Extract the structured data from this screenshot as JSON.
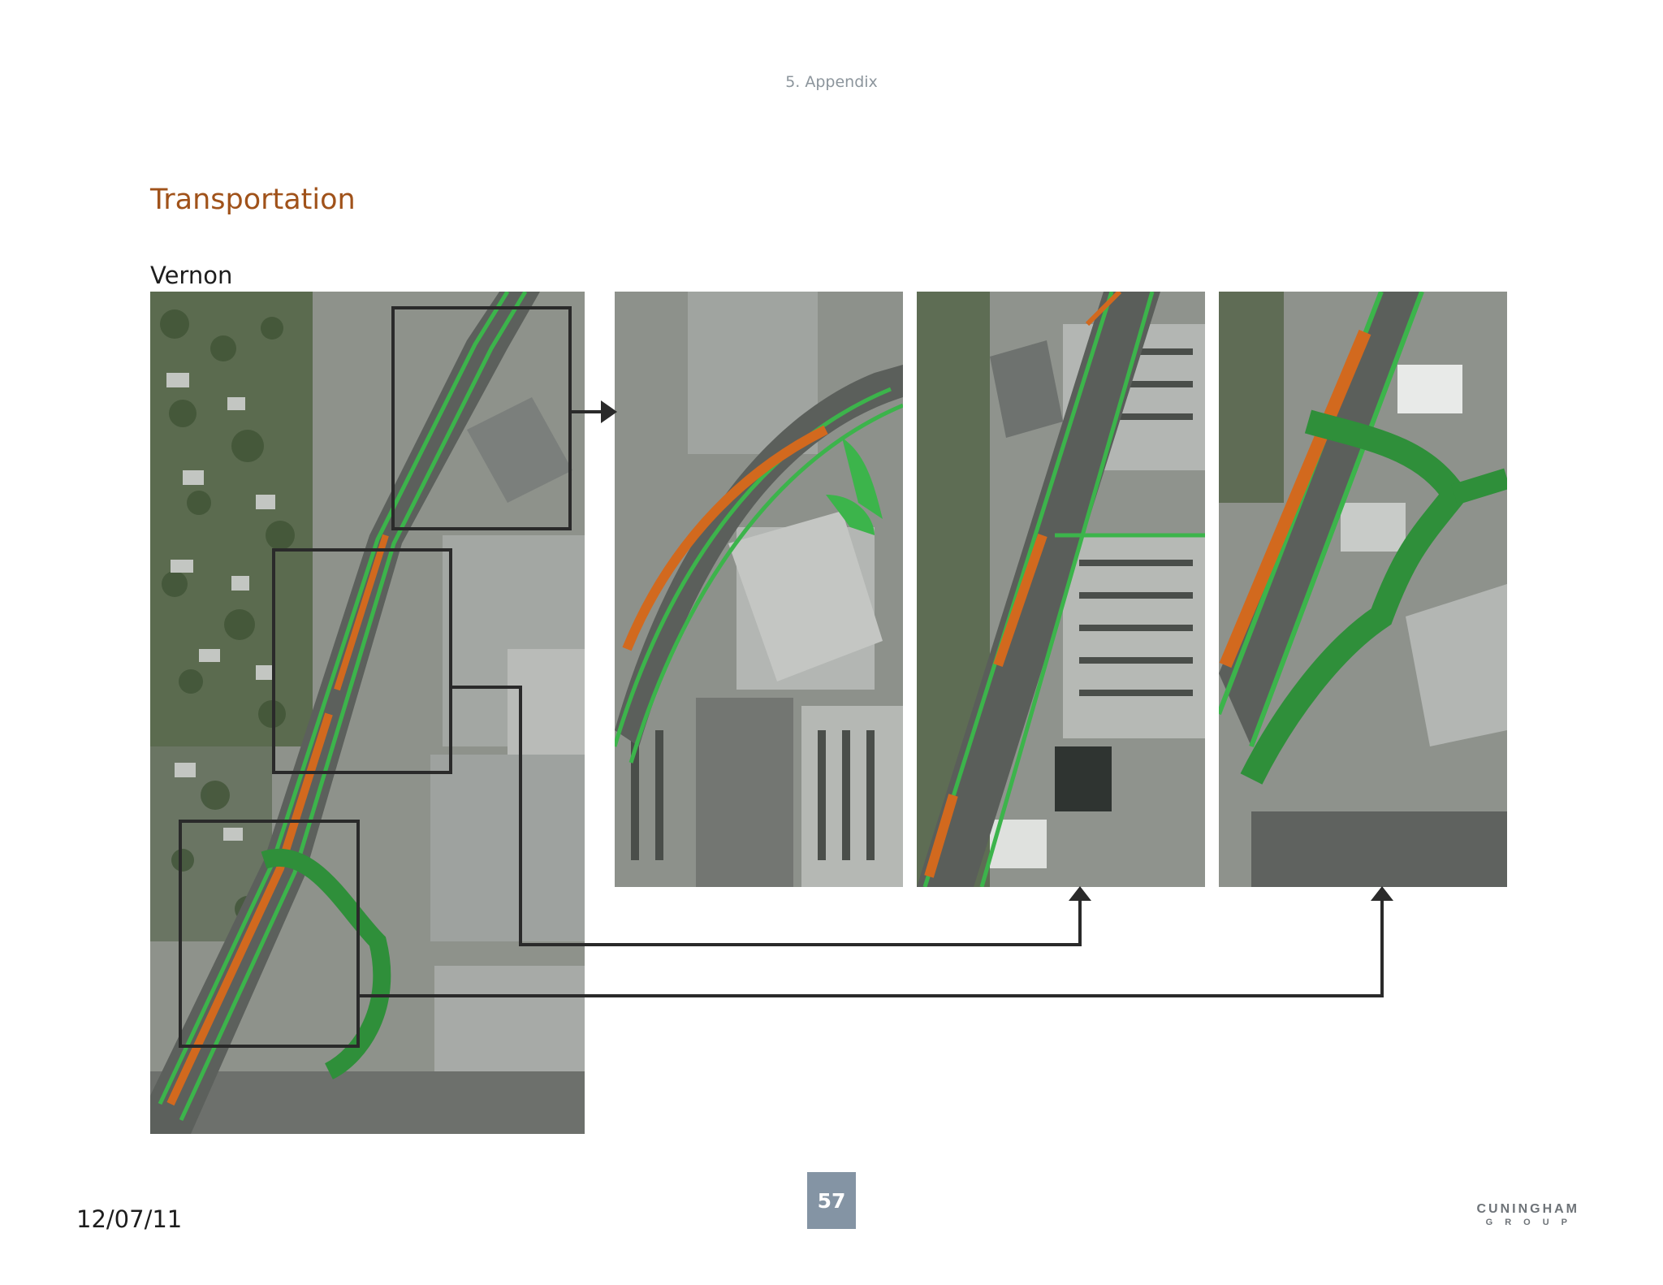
{
  "header": {
    "section": "5. Appendix"
  },
  "content": {
    "title": "Transportation",
    "place": "Vernon"
  },
  "footer": {
    "date": "12/07/11",
    "page_number": "57",
    "logo_top": "CUNINGHAM",
    "logo_bottom": "GROUP"
  },
  "colors": {
    "title": "#a0521a",
    "median": "#d2691e",
    "landscape": "#3cb44b",
    "callout_box": "#2a2a2a",
    "page_number_bg": "#8494a4"
  },
  "icons": [
    "arrow-right-icon",
    "arrow-up-icon"
  ]
}
